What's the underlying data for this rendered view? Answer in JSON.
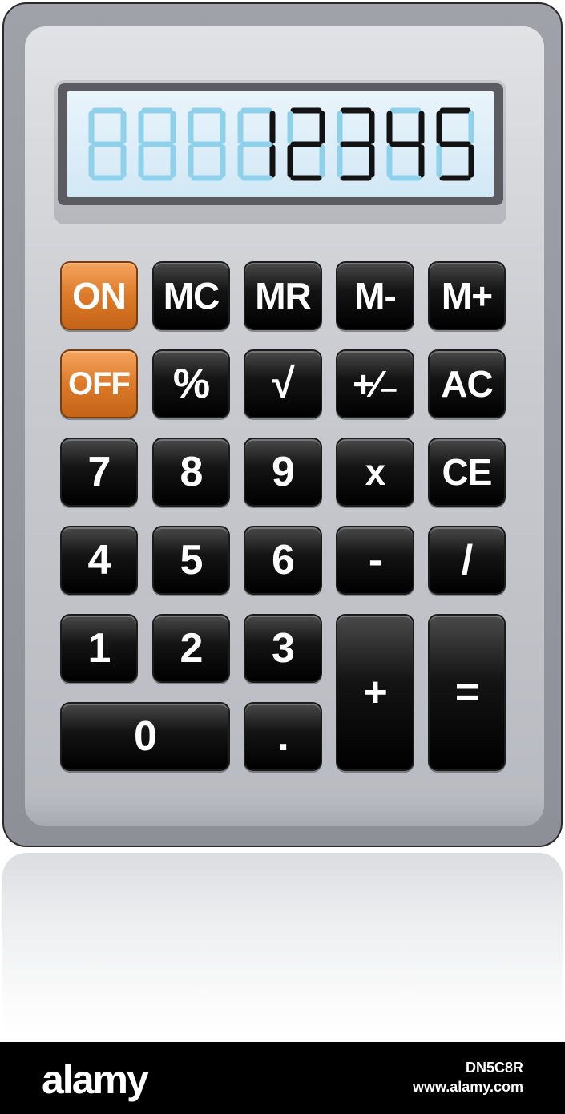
{
  "display": {
    "value": "12345",
    "digit_positions": 8,
    "ghost_color": "#8fd0ea",
    "on_color": "#121212"
  },
  "keys": {
    "on": "ON",
    "off": "OFF",
    "mc": "MC",
    "mr": "MR",
    "m_minus": "M-",
    "m_plus": "M+",
    "percent": "%",
    "sqrt": "√",
    "plus_minus": "+⁄₋",
    "ac": "AC",
    "seven": "7",
    "eight": "8",
    "nine": "9",
    "multiply": "x",
    "ce": "CE",
    "four": "4",
    "five": "5",
    "six": "6",
    "minus": "-",
    "divide": "/",
    "one": "1",
    "two": "2",
    "three": "3",
    "plus": "+",
    "equals": "=",
    "zero": "0",
    "decimal": "."
  },
  "colors": {
    "key_black": "#000000",
    "key_orange": "#dd7a2a"
  },
  "watermark": {
    "logo": "alamy",
    "image_id": "DN5C8R",
    "url": "www.alamy.com"
  }
}
